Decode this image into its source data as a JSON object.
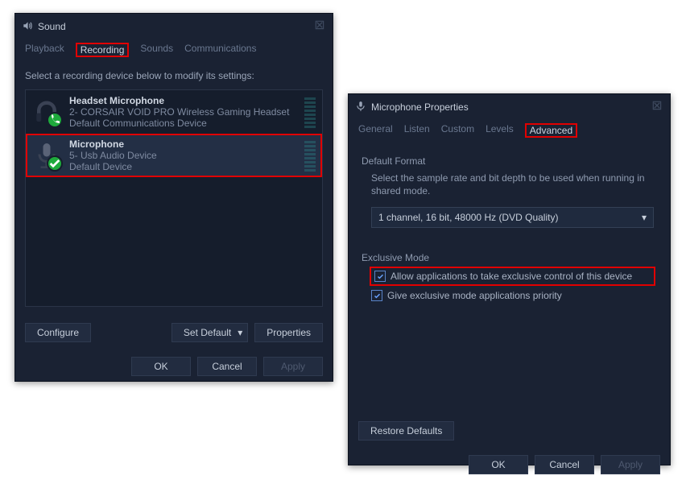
{
  "sound": {
    "title": "Sound",
    "tabs": [
      "Playback",
      "Recording",
      "Sounds",
      "Communications"
    ],
    "active_tab": "Recording",
    "instruction": "Select a recording device below to modify its settings:",
    "devices": [
      {
        "name": "Headset Microphone",
        "sub": "2- CORSAIR VOID PRO Wireless Gaming Headset",
        "status": "Default Communications Device",
        "badge": "phone"
      },
      {
        "name": "Microphone",
        "sub": "5- Usb Audio Device",
        "status": "Default Device",
        "badge": "check"
      }
    ],
    "buttons": {
      "configure": "Configure",
      "set_default": "Set Default",
      "properties": "Properties",
      "ok": "OK",
      "cancel": "Cancel",
      "apply": "Apply"
    }
  },
  "props": {
    "title": "Microphone Properties",
    "tabs": [
      "General",
      "Listen",
      "Custom",
      "Levels",
      "Advanced"
    ],
    "active_tab": "Advanced",
    "default_format": {
      "heading": "Default Format",
      "desc": "Select the sample rate and bit depth to be used when running in shared mode.",
      "value": "1 channel, 16 bit, 48000 Hz (DVD Quality)"
    },
    "exclusive": {
      "heading": "Exclusive Mode",
      "opt1": "Allow applications to take exclusive control of this device",
      "opt2": "Give exclusive mode applications priority"
    },
    "buttons": {
      "restore": "Restore Defaults",
      "ok": "OK",
      "cancel": "Cancel",
      "apply": "Apply"
    }
  }
}
